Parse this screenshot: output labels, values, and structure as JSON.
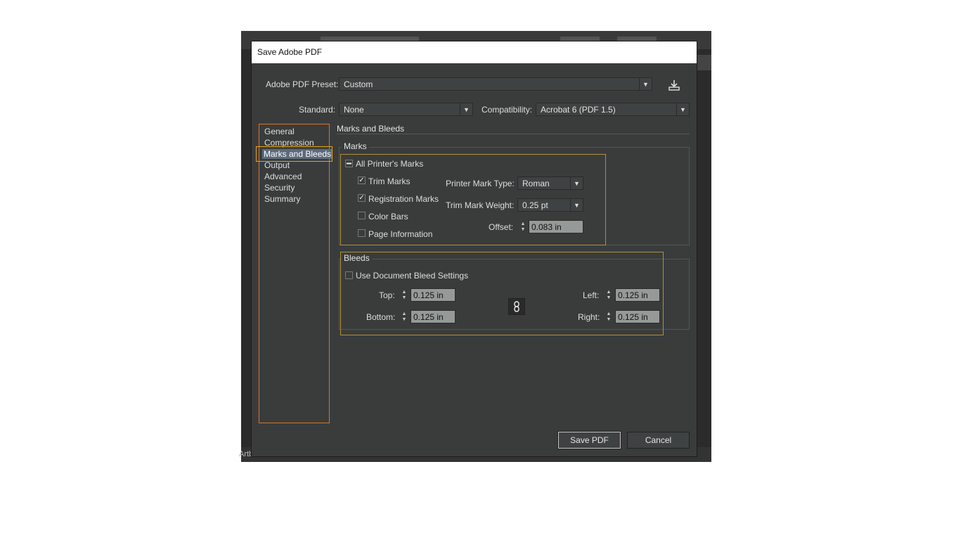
{
  "dialog": {
    "title": "Save Adobe PDF"
  },
  "preset": {
    "label": "Adobe PDF Preset:",
    "value": "Custom"
  },
  "standard": {
    "label": "Standard:",
    "value": "None"
  },
  "compatibility": {
    "label": "Compatibility:",
    "value": "Acrobat 6 (PDF 1.5)"
  },
  "nav": {
    "items": [
      {
        "label": "General"
      },
      {
        "label": "Compression"
      },
      {
        "label": "Marks and Bleeds"
      },
      {
        "label": "Output"
      },
      {
        "label": "Advanced"
      },
      {
        "label": "Security"
      },
      {
        "label": "Summary"
      }
    ],
    "selected": "Marks and Bleeds"
  },
  "section_title": "Marks and Bleeds",
  "marks": {
    "group_title": "Marks",
    "all_printers_marks": {
      "label": "All Printer's Marks",
      "state": "mixed"
    },
    "trim_marks": {
      "label": "Trim Marks",
      "checked": true
    },
    "registration_marks": {
      "label": "Registration Marks",
      "checked": true
    },
    "color_bars": {
      "label": "Color Bars",
      "checked": false
    },
    "page_information": {
      "label": "Page Information",
      "checked": false
    },
    "printer_mark_type": {
      "label": "Printer Mark Type:",
      "value": "Roman"
    },
    "trim_mark_weight": {
      "label": "Trim Mark Weight:",
      "value": "0.25 pt"
    },
    "offset": {
      "label": "Offset:",
      "value": "0.083 in"
    }
  },
  "bleeds": {
    "group_title": "Bleeds",
    "use_document_bleed": {
      "label": "Use Document Bleed Settings",
      "checked": false
    },
    "top": {
      "label": "Top:",
      "value": "0.125 in"
    },
    "bottom": {
      "label": "Bottom:",
      "value": "0.125 in"
    },
    "left": {
      "label": "Left:",
      "value": "0.125 in"
    },
    "right": {
      "label": "Right:",
      "value": "0.125 in"
    }
  },
  "buttons": {
    "save": "Save PDF",
    "cancel": "Cancel"
  },
  "background_app": {
    "status_text": "Artboard"
  },
  "colors": {
    "dialog_bg": "#3a3c3c",
    "nav_border": "#d8742a",
    "highlight_border": "#e5a61b",
    "selection": "#5b6b7c"
  }
}
